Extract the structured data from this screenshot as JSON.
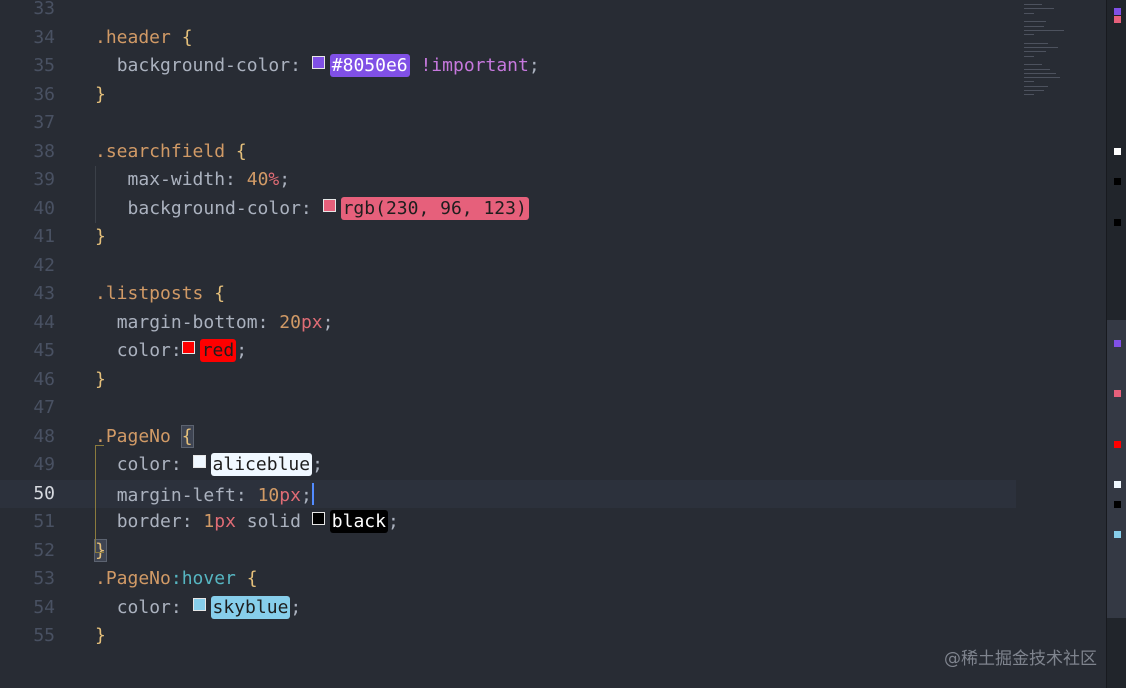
{
  "lines": [
    {
      "n": "33",
      "parts": []
    },
    {
      "n": "34",
      "parts": [
        {
          "c": "sel",
          "t": ".header"
        },
        {
          "c": "",
          "t": " "
        },
        {
          "c": "brace",
          "t": "{"
        }
      ]
    },
    {
      "n": "35",
      "parts": [
        {
          "c": "",
          "t": "  "
        },
        {
          "c": "prop",
          "t": "background-color: "
        },
        {
          "c": "swatch",
          "color": "#8050e6"
        },
        {
          "c": "chip",
          "t": "#8050e6",
          "bg": "#8050e6",
          "fg": "#ffffff"
        },
        {
          "c": "",
          "t": " "
        },
        {
          "c": "kw",
          "t": "!important"
        },
        {
          "c": "",
          "t": ";"
        }
      ]
    },
    {
      "n": "36",
      "parts": [
        {
          "c": "brace",
          "t": "}"
        }
      ]
    },
    {
      "n": "37",
      "parts": []
    },
    {
      "n": "38",
      "parts": [
        {
          "c": "sel",
          "t": ".searchfield"
        },
        {
          "c": "",
          "t": " "
        },
        {
          "c": "brace",
          "t": "{"
        }
      ]
    },
    {
      "n": "39",
      "parts": [
        {
          "c": "",
          "t": "   "
        },
        {
          "c": "prop",
          "t": "max-width: "
        },
        {
          "c": "num",
          "t": "40"
        },
        {
          "c": "unit",
          "t": "%"
        },
        {
          "c": "",
          "t": ";"
        }
      ]
    },
    {
      "n": "40",
      "parts": [
        {
          "c": "",
          "t": "   "
        },
        {
          "c": "prop",
          "t": "background-color: "
        },
        {
          "c": "swatch",
          "color": "#e6607b"
        },
        {
          "c": "chip",
          "t": "rgb(230, 96, 123)",
          "bg": "#e6607b",
          "fg": "#1e1e1e"
        }
      ]
    },
    {
      "n": "41",
      "parts": [
        {
          "c": "brace",
          "t": "}"
        }
      ]
    },
    {
      "n": "42",
      "parts": []
    },
    {
      "n": "43",
      "parts": [
        {
          "c": "sel",
          "t": ".listposts"
        },
        {
          "c": "",
          "t": " "
        },
        {
          "c": "brace",
          "t": "{"
        }
      ]
    },
    {
      "n": "44",
      "parts": [
        {
          "c": "",
          "t": "  "
        },
        {
          "c": "prop",
          "t": "margin-bottom: "
        },
        {
          "c": "num",
          "t": "20"
        },
        {
          "c": "unit",
          "t": "px"
        },
        {
          "c": "",
          "t": ";"
        }
      ]
    },
    {
      "n": "45",
      "parts": [
        {
          "c": "",
          "t": "  "
        },
        {
          "c": "prop",
          "t": "color:"
        },
        {
          "c": "swatch",
          "color": "#ff0000"
        },
        {
          "c": "chip",
          "t": "red",
          "bg": "#ff0000",
          "fg": "#1e1e1e"
        },
        {
          "c": "",
          "t": ";"
        }
      ]
    },
    {
      "n": "46",
      "parts": [
        {
          "c": "brace",
          "t": "}"
        }
      ]
    },
    {
      "n": "47",
      "parts": []
    },
    {
      "n": "48",
      "parts": [
        {
          "c": "sel",
          "t": ".PageNo"
        },
        {
          "c": "",
          "t": " "
        },
        {
          "c": "brace brace-match",
          "t": "{"
        }
      ]
    },
    {
      "n": "49",
      "parts": [
        {
          "c": "",
          "t": "  "
        },
        {
          "c": "prop",
          "t": "color: "
        },
        {
          "c": "swatch",
          "color": "#f0f8ff"
        },
        {
          "c": "chip",
          "t": "aliceblue",
          "bg": "#f0f8ff",
          "fg": "#1e1e1e"
        },
        {
          "c": "",
          "t": ";"
        }
      ]
    },
    {
      "n": "50",
      "parts": [
        {
          "c": "",
          "t": "  "
        },
        {
          "c": "prop",
          "t": "margin-left: "
        },
        {
          "c": "num",
          "t": "10"
        },
        {
          "c": "unit",
          "t": "px"
        },
        {
          "c": "",
          "t": ";"
        },
        {
          "c": "cursor",
          "t": ""
        }
      ],
      "current": true
    },
    {
      "n": "51",
      "parts": [
        {
          "c": "",
          "t": "  "
        },
        {
          "c": "prop",
          "t": "border: "
        },
        {
          "c": "num",
          "t": "1"
        },
        {
          "c": "unit",
          "t": "px"
        },
        {
          "c": "prop",
          "t": " solid "
        },
        {
          "c": "swatch",
          "color": "#000000"
        },
        {
          "c": "chip",
          "t": "black",
          "bg": "#000000",
          "fg": "#ffffff"
        },
        {
          "c": "",
          "t": ";"
        }
      ]
    },
    {
      "n": "52",
      "parts": [
        {
          "c": "brace brace-match",
          "t": "}"
        }
      ]
    },
    {
      "n": "53",
      "parts": [
        {
          "c": "sel",
          "t": ".PageNo"
        },
        {
          "c": "pseudo",
          "t": ":hover"
        },
        {
          "c": "",
          "t": " "
        },
        {
          "c": "brace",
          "t": "{"
        }
      ]
    },
    {
      "n": "54",
      "parts": [
        {
          "c": "",
          "t": "  "
        },
        {
          "c": "prop",
          "t": "color: "
        },
        {
          "c": "swatch",
          "color": "#87ceeb"
        },
        {
          "c": "chip",
          "t": "skyblue",
          "bg": "#87ceeb",
          "fg": "#1e1e1e"
        },
        {
          "c": "",
          "t": ";"
        }
      ]
    },
    {
      "n": "55",
      "parts": [
        {
          "c": "brace",
          "t": "}"
        }
      ]
    }
  ],
  "scrollbar_marks": [
    "#8050e6",
    "#e6607b",
    "#ffffff",
    "#000000",
    "#000000",
    "#8050e6",
    "#e6607b",
    "#ff0000",
    "#f0f8ff",
    "#000000",
    "#87ceeb"
  ],
  "watermark": "@稀土掘金技术社区"
}
